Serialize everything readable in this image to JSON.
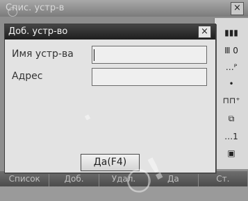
{
  "background_window": {
    "title": "Спис. устр-в",
    "close_glyph": "×"
  },
  "right_panel": {
    "items": [
      "▮▮▮",
      "Ⅲ 0",
      "…ᴾ",
      "•",
      "⊓⊓⁺",
      "⧉",
      "…1",
      "▣"
    ]
  },
  "softkeys": [
    "Список",
    "Доб.",
    "Удал.",
    "Да",
    "Ст."
  ],
  "dialog": {
    "title": "Доб. устр-во",
    "close_glyph": "×",
    "fields": {
      "name_label": "Имя устр-ва",
      "name_value": "",
      "address_label": "Адрес",
      "address_value": ""
    },
    "ok_label": "Да(F4)"
  }
}
